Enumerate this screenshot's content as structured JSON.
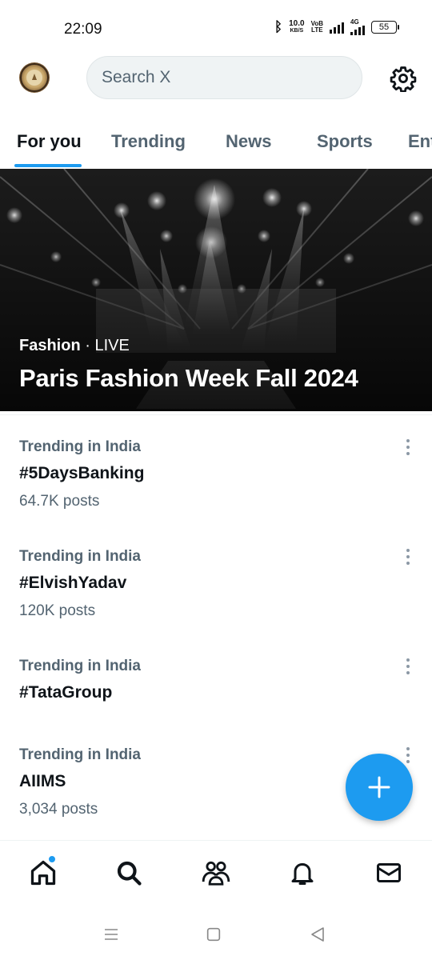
{
  "status_bar": {
    "time": "22:09",
    "net_speed_value": "10.0",
    "net_speed_unit": "KB/S",
    "volte_top": "VoB",
    "volte_bottom": "LTE",
    "network_type": "4G",
    "battery": "55"
  },
  "header": {
    "search_placeholder": "Search X",
    "avatar_icon": "user-avatar",
    "settings_icon": "gear-icon"
  },
  "tabs": [
    {
      "label": "For you",
      "active": true
    },
    {
      "label": "Trending",
      "active": false
    },
    {
      "label": "News",
      "active": false
    },
    {
      "label": "Sports",
      "active": false
    },
    {
      "label": "Ent",
      "active": false
    }
  ],
  "hero": {
    "category": "Fashion",
    "separator": " · ",
    "status": "LIVE",
    "title": "Paris Fashion Week Fall 2024"
  },
  "trends": [
    {
      "context": "Trending in India",
      "name": "#5DaysBanking",
      "count": "64.7K posts"
    },
    {
      "context": "Trending in India",
      "name": "#ElvishYadav",
      "count": "120K posts"
    },
    {
      "context": "Trending in India",
      "name": "#TataGroup",
      "count": ""
    },
    {
      "context": "Trending in India",
      "name": "AIIMS",
      "count": "3,034 posts"
    }
  ],
  "fab": {
    "icon": "plus-icon",
    "color": "#1d9bf0"
  },
  "bottom_nav": {
    "items": [
      "home-icon",
      "search-icon",
      "communities-icon",
      "notifications-icon",
      "messages-icon"
    ],
    "home_has_unread": true
  },
  "colors": {
    "accent": "#1d9bf0",
    "text_primary": "#0f1419",
    "text_secondary": "#536471"
  }
}
